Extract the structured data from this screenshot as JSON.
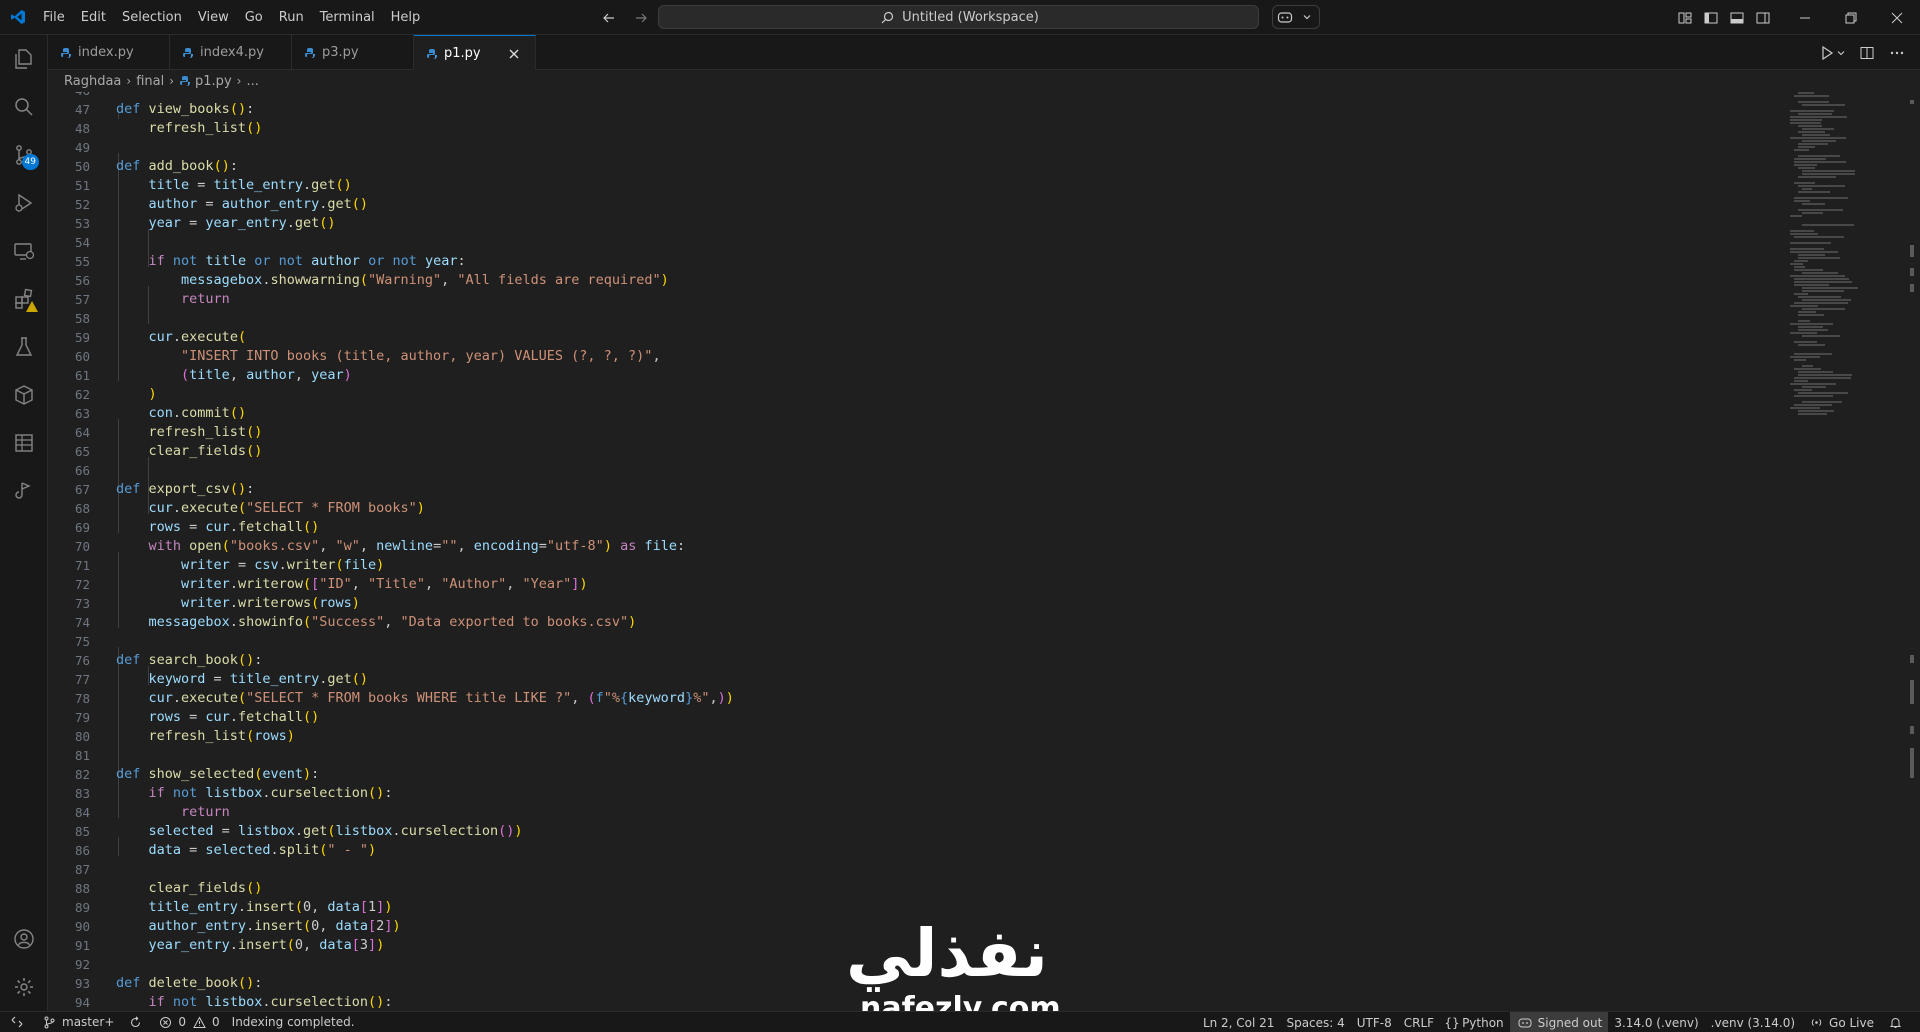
{
  "titlebar": {
    "menu": [
      "File",
      "Edit",
      "Selection",
      "View",
      "Go",
      "Run",
      "Terminal",
      "Help"
    ],
    "search_text": "Untitled (Workspace)"
  },
  "activity": {
    "scm_badge": "49"
  },
  "tabs": [
    {
      "label": "index.py",
      "active": false
    },
    {
      "label": "index4.py",
      "active": false
    },
    {
      "label": "p3.py",
      "active": false
    },
    {
      "label": "p1.py",
      "active": true
    }
  ],
  "breadcrumbs": [
    "Raghdaa",
    "final",
    "p1.py",
    "..."
  ],
  "editor": {
    "partial_top_line": "46",
    "lines": [
      {
        "n": "47",
        "html": "<span class='kw'>def</span> <span class='fn'>view_books</span><span class='br1'>()</span>:"
      },
      {
        "n": "48",
        "html": "    <span class='fn'>refresh_list</span><span class='br1'>()</span>"
      },
      {
        "n": "49",
        "html": ""
      },
      {
        "n": "50",
        "html": "<span class='kw'>def</span> <span class='fn'>add_book</span><span class='br1'>()</span>:"
      },
      {
        "n": "51",
        "html": "    <span class='var'>title</span> = <span class='var'>title_entry</span>.<span class='fn'>get</span><span class='br1'>()</span>"
      },
      {
        "n": "52",
        "html": "    <span class='var'>author</span> = <span class='var'>author_entry</span>.<span class='fn'>get</span><span class='br1'>()</span>"
      },
      {
        "n": "53",
        "html": "    <span class='var'>year</span> = <span class='var'>year_entry</span>.<span class='fn'>get</span><span class='br1'>()</span>"
      },
      {
        "n": "54",
        "html": ""
      },
      {
        "n": "55",
        "html": "    <span class='kw2'>if</span> <span class='kw'>not</span> <span class='var'>title</span> <span class='kw'>or</span> <span class='kw'>not</span> <span class='var'>author</span> <span class='kw'>or</span> <span class='kw'>not</span> <span class='var'>year</span>:"
      },
      {
        "n": "56",
        "html": "        <span class='var'>messagebox</span>.<span class='fn'>showwarning</span><span class='br1'>(</span><span class='str'>\"Warning\"</span>, <span class='str'>\"All fields are required\"</span><span class='br1'>)</span>"
      },
      {
        "n": "57",
        "html": "        <span class='kw2'>return</span>"
      },
      {
        "n": "58",
        "html": ""
      },
      {
        "n": "59",
        "html": "    <span class='var'>cur</span>.<span class='fn'>execute</span><span class='br1'>(</span>"
      },
      {
        "n": "60",
        "html": "        <span class='str'>\"INSERT INTO books (title, author, year) VALUES (?, ?, ?)\"</span>,"
      },
      {
        "n": "61",
        "html": "        <span class='br2'>(</span><span class='var'>title</span>, <span class='var'>author</span>, <span class='var'>year</span><span class='br2'>)</span>"
      },
      {
        "n": "62",
        "html": "    <span class='br1'>)</span>"
      },
      {
        "n": "63",
        "html": "    <span class='var'>con</span>.<span class='fn'>commit</span><span class='br1'>()</span>"
      },
      {
        "n": "64",
        "html": "    <span class='fn'>refresh_list</span><span class='br1'>()</span>"
      },
      {
        "n": "65",
        "html": "    <span class='fn'>clear_fields</span><span class='br1'>()</span>"
      },
      {
        "n": "66",
        "html": ""
      },
      {
        "n": "67",
        "html": "<span class='kw'>def</span> <span class='fn'>export_csv</span><span class='br1'>()</span>:"
      },
      {
        "n": "68",
        "html": "    <span class='var'>cur</span>.<span class='fn'>execute</span><span class='br1'>(</span><span class='str'>\"SELECT * FROM books\"</span><span class='br1'>)</span>"
      },
      {
        "n": "69",
        "html": "    <span class='var'>rows</span> = <span class='var'>cur</span>.<span class='fn'>fetchall</span><span class='br1'>()</span>"
      },
      {
        "n": "70",
        "html": "    <span class='kw2'>with</span> <span class='fn'>open</span><span class='br1'>(</span><span class='str'>\"books.csv\"</span>, <span class='str'>\"w\"</span>, <span class='var'>newline</span>=<span class='str'>\"\"</span>, <span class='var'>encoding</span>=<span class='str'>\"utf-8\"</span><span class='br1'>)</span> <span class='kw2'>as</span> <span class='var'>file</span>:"
      },
      {
        "n": "71",
        "html": "        <span class='var'>writer</span> = <span class='var'>csv</span>.<span class='fn'>writer</span><span class='br1'>(</span><span class='var'>file</span><span class='br1'>)</span>"
      },
      {
        "n": "72",
        "html": "        <span class='var'>writer</span>.<span class='fn'>writerow</span><span class='br1'>(</span><span class='br2'>[</span><span class='str'>\"ID\"</span>, <span class='str'>\"Title\"</span>, <span class='str'>\"Author\"</span>, <span class='str'>\"Year\"</span><span class='br2'>]</span><span class='br1'>)</span>"
      },
      {
        "n": "73",
        "html": "        <span class='var'>writer</span>.<span class='fn'>writerows</span><span class='br1'>(</span><span class='var'>rows</span><span class='br1'>)</span>"
      },
      {
        "n": "74",
        "html": "    <span class='var'>messagebox</span>.<span class='fn'>showinfo</span><span class='br1'>(</span><span class='str'>\"Success\"</span>, <span class='str'>\"Data exported to books.csv\"</span><span class='br1'>)</span>"
      },
      {
        "n": "75",
        "html": ""
      },
      {
        "n": "76",
        "html": "<span class='kw'>def</span> <span class='fn'>search_book</span><span class='br1'>()</span>:"
      },
      {
        "n": "77",
        "html": "    <span class='var'>keyword</span> = <span class='var'>title_entry</span>.<span class='fn'>get</span><span class='br1'>()</span>"
      },
      {
        "n": "78",
        "html": "    <span class='var'>cur</span>.<span class='fn'>execute</span><span class='br1'>(</span><span class='str'>\"SELECT * FROM books WHERE title LIKE ?\"</span>, <span class='br2'>(</span><span class='kw'>f</span><span class='str'>\"%</span><span class='kw'>{</span><span class='var'>keyword</span><span class='kw'>}</span><span class='str'>%\"</span>,<span class='br2'>)</span><span class='br1'>)</span>"
      },
      {
        "n": "79",
        "html": "    <span class='var'>rows</span> = <span class='var'>cur</span>.<span class='fn'>fetchall</span><span class='br1'>()</span>"
      },
      {
        "n": "80",
        "html": "    <span class='fn'>refresh_list</span><span class='br1'>(</span><span class='var'>rows</span><span class='br1'>)</span>"
      },
      {
        "n": "81",
        "html": ""
      },
      {
        "n": "82",
        "html": "<span class='kw'>def</span> <span class='fn'>show_selected</span><span class='br1'>(</span><span class='var'>event</span><span class='br1'>)</span>:"
      },
      {
        "n": "83",
        "html": "    <span class='kw2'>if</span> <span class='kw'>not</span> <span class='var'>listbox</span>.<span class='fn'>curselection</span><span class='br1'>()</span>:"
      },
      {
        "n": "84",
        "html": "        <span class='kw2'>return</span>"
      },
      {
        "n": "85",
        "html": "    <span class='var'>selected</span> = <span class='var'>listbox</span>.<span class='fn'>get</span><span class='br1'>(</span><span class='var'>listbox</span>.<span class='fn'>curselection</span><span class='br2'>()</span><span class='br1'>)</span>"
      },
      {
        "n": "86",
        "html": "    <span class='var'>data</span> = <span class='var'>selected</span>.<span class='fn'>split</span><span class='br1'>(</span><span class='str'>\" - \"</span><span class='br1'>)</span>"
      },
      {
        "n": "87",
        "html": ""
      },
      {
        "n": "88",
        "html": "    <span class='fn'>clear_fields</span><span class='br1'>()</span>"
      },
      {
        "n": "89",
        "html": "    <span class='var'>title_entry</span>.<span class='fn'>insert</span><span class='br1'>(</span>0, <span class='var'>data</span><span class='br2'>[</span>1<span class='br2'>]</span><span class='br1'>)</span>"
      },
      {
        "n": "90",
        "html": "    <span class='var'>author_entry</span>.<span class='fn'>insert</span><span class='br1'>(</span>0, <span class='var'>data</span><span class='br2'>[</span>2<span class='br2'>]</span><span class='br1'>)</span>"
      },
      {
        "n": "91",
        "html": "    <span class='var'>year_entry</span>.<span class='fn'>insert</span><span class='br1'>(</span>0, <span class='var'>data</span><span class='br2'>[</span>3<span class='br2'>]</span><span class='br1'>)</span>"
      },
      {
        "n": "92",
        "html": ""
      },
      {
        "n": "93",
        "html": "<span class='kw'>def</span> <span class='fn'>delete_book</span><span class='br1'>()</span>:"
      },
      {
        "n": "94",
        "html": "    <span class='kw2'>if</span> <span class='kw'>not</span> <span class='var'>listbox</span>.<span class='fn'>curselection</span><span class='br1'>()</span>:"
      }
    ]
  },
  "statusbar": {
    "branch": "master+",
    "errors": "0",
    "warnings": "0",
    "message": "Indexing completed.",
    "position": "Ln 2, Col 21",
    "spaces": "Spaces: 4",
    "encoding": "UTF-8",
    "eol": "CRLF",
    "language": "Python",
    "signed_out": "Signed out",
    "interpreter": "3.14.0 (.venv)",
    "venv": ".venv (3.14.0)",
    "go_live": "Go Live"
  },
  "watermark": {
    "arabic": "نفذلي",
    "latin": "nafezly.com"
  },
  "colors": {
    "accent": "#0078d4",
    "keyword": "#569cd6",
    "control": "#c586c0",
    "function": "#dcdcaa",
    "string": "#ce9178",
    "variable": "#9cdcfe"
  }
}
